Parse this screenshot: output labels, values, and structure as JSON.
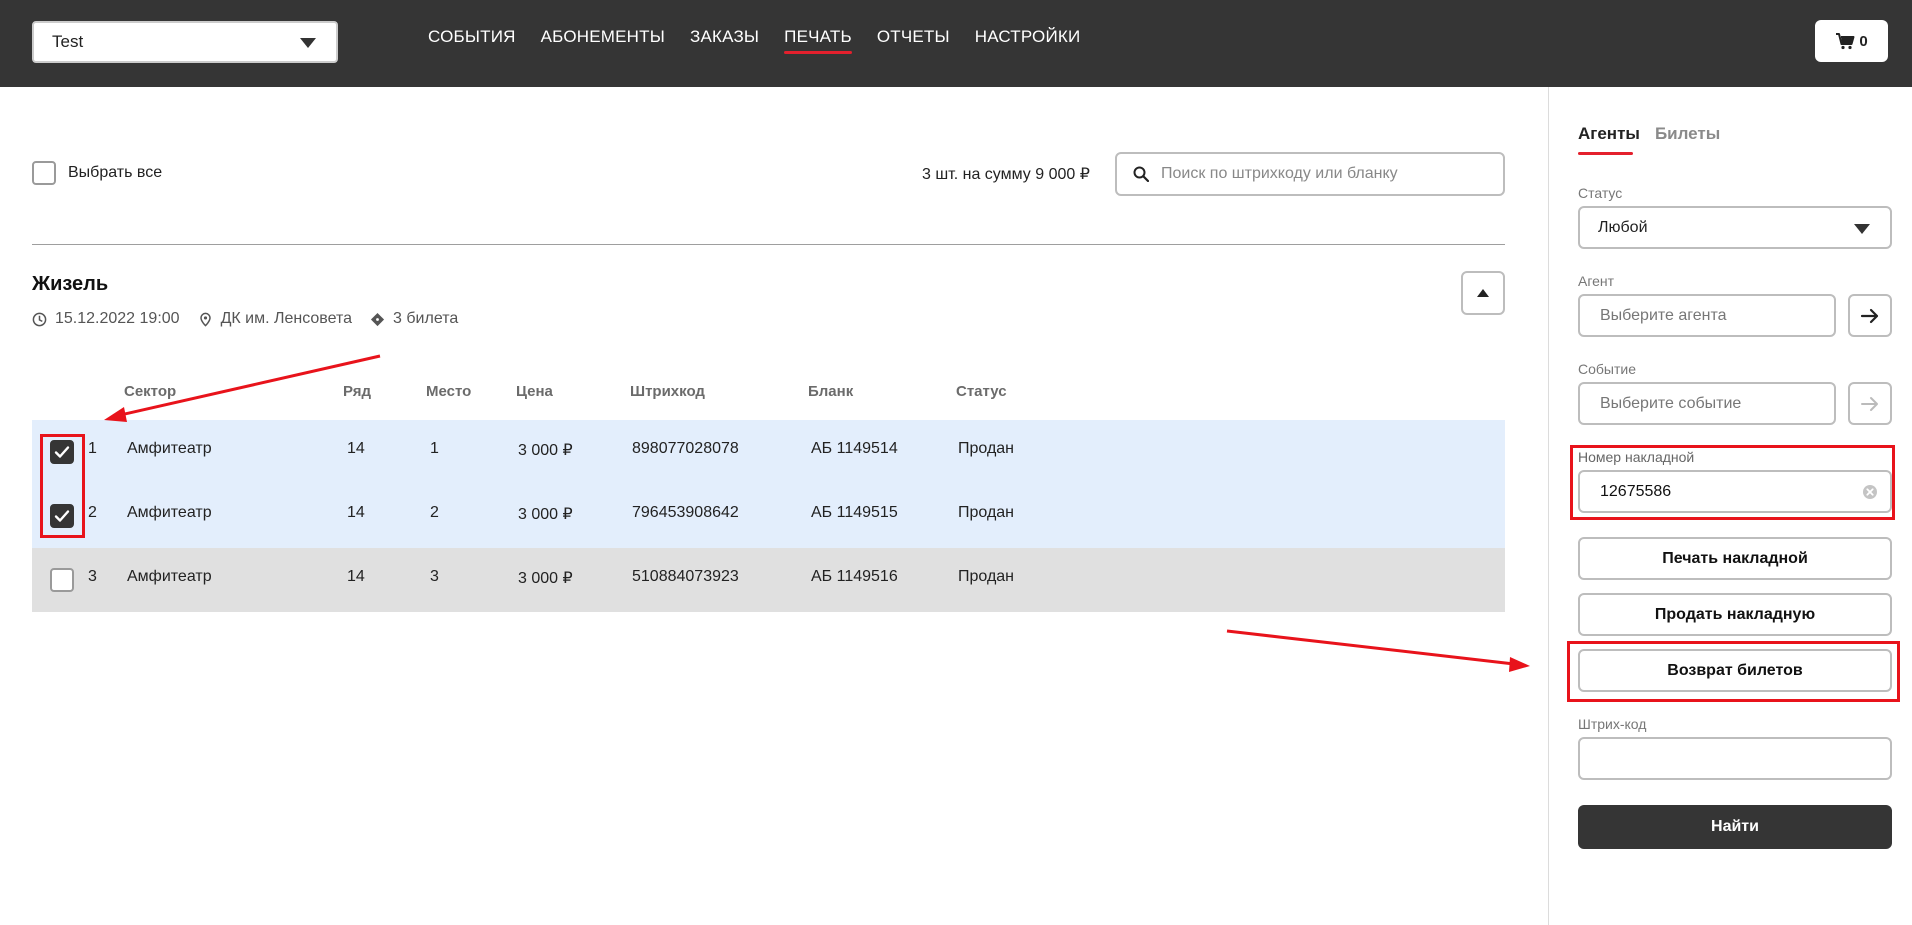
{
  "header": {
    "venue_select": "Test",
    "nav": [
      {
        "label": "СОБЫТИЯ",
        "active": false
      },
      {
        "label": "АБОНЕМЕНТЫ",
        "active": false
      },
      {
        "label": "ЗАКАЗЫ",
        "active": false
      },
      {
        "label": "ПЕЧАТЬ",
        "active": true
      },
      {
        "label": "ОТЧЕТЫ",
        "active": false
      },
      {
        "label": "НАСТРОЙКИ",
        "active": false
      }
    ],
    "cart_count": "0"
  },
  "toolbar": {
    "select_all_label": "Выбрать все",
    "summary": "3 шт. на сумму 9 000 ₽",
    "search_placeholder": "Поиск по штрихкоду или бланку"
  },
  "event": {
    "title": "Жизель",
    "datetime": "15.12.2022 19:00",
    "venue": "ДК им. Ленсовета",
    "tickets_count": "3 билета"
  },
  "table": {
    "columns": [
      "Сектор",
      "Ряд",
      "Место",
      "Цена",
      "Штрихкод",
      "Бланк",
      "Статус"
    ],
    "rows": [
      {
        "num": "1",
        "sector": "Амфитеатр",
        "row": "14",
        "seat": "1",
        "price": "3 000 ₽",
        "barcode": "898077028078",
        "blank": "АБ 1149514",
        "status": "Продан",
        "checked": true
      },
      {
        "num": "2",
        "sector": "Амфитеатр",
        "row": "14",
        "seat": "2",
        "price": "3 000 ₽",
        "barcode": "796453908642",
        "blank": "АБ 1149515",
        "status": "Продан",
        "checked": true
      },
      {
        "num": "3",
        "sector": "Амфитеатр",
        "row": "14",
        "seat": "3",
        "price": "3 000 ₽",
        "barcode": "510884073923",
        "blank": "АБ 1149516",
        "status": "Продан",
        "checked": false
      }
    ]
  },
  "panel": {
    "tabs": [
      {
        "label": "Агенты",
        "active": true
      },
      {
        "label": "Билеты",
        "active": false
      }
    ],
    "status_label": "Статус",
    "status_value": "Любой",
    "agent_label": "Агент",
    "agent_placeholder": "Выберите агента",
    "event_label": "Событие",
    "event_placeholder": "Выберите событие",
    "invoice_label": "Номер накладной",
    "invoice_value": "12675586",
    "print_invoice_button": "Печать накладной",
    "sell_invoice_button": "Продать накладную",
    "return_tickets_button": "Возврат билетов",
    "barcode_label": "Штрих-код",
    "barcode_value": "",
    "find_button": "Найти"
  },
  "colors": {
    "header_bg": "#353535",
    "accent_red": "#e4202d",
    "selected_row_bg": "#e3eefc",
    "unselected_row_bg": "#e0e0e0"
  }
}
